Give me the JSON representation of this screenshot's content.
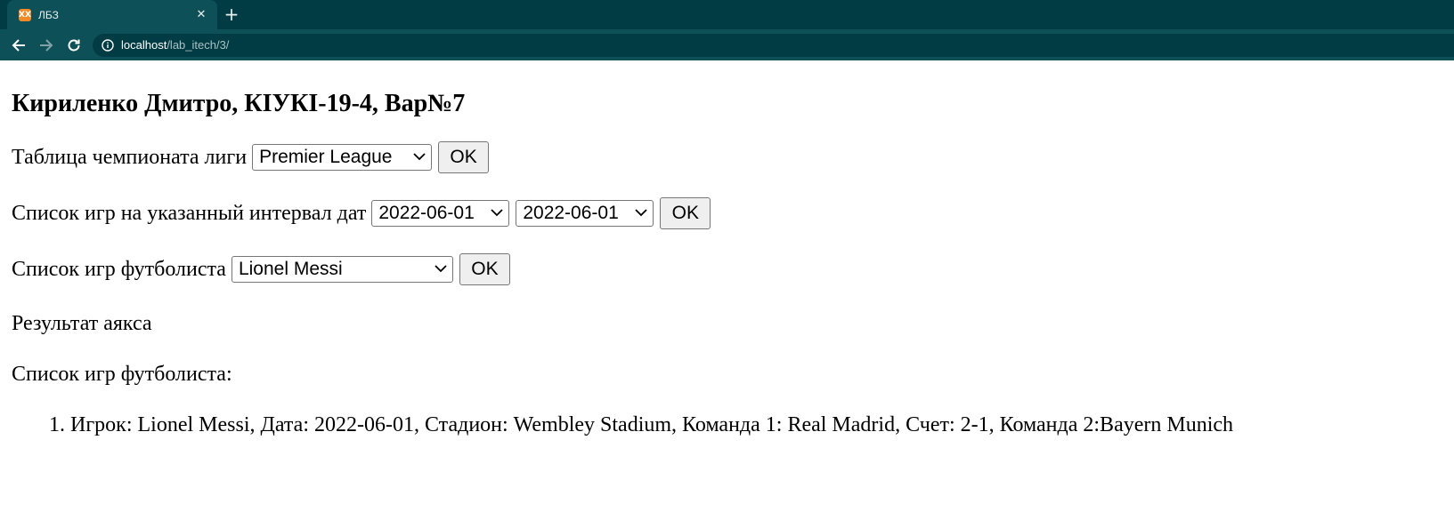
{
  "browser": {
    "tab_title": "ЛБЗ",
    "favicon_glyph": "XX",
    "close_glyph": "✕",
    "new_tab_glyph": "+",
    "url_host": "localhost",
    "url_path": "/lab_itech/3/",
    "colors": {
      "tabstrip": "#013b43",
      "toolbar": "#0d5058"
    },
    "icons": [
      "back-arrow-icon",
      "forward-arrow-icon",
      "reload-icon",
      "info-icon",
      "close-icon",
      "plus-icon"
    ]
  },
  "page": {
    "heading": "Кириленко Дмитро, КІУКІ-19-4, Вар№7",
    "league_form": {
      "label": "Таблица чемпионата лиги",
      "selected": "Premier League",
      "ok_label": "OK"
    },
    "dates_form": {
      "label": "Список игр на указанный интервал дат",
      "date_from": "2022-06-01",
      "date_to": "2022-06-01",
      "ok_label": "OK"
    },
    "player_form": {
      "label": "Список игр футболиста",
      "selected": "Lionel Messi",
      "ok_label": "OK"
    },
    "ajax_result": "Результат аякса",
    "list_heading": "Список игр футболиста:",
    "games": [
      "Игрок: Lionel Messi, Дата: 2022-06-01, Стадион: Wembley Stadium, Команда 1: Real Madrid, Счет: 2-1, Команда 2:Bayern Munich"
    ]
  }
}
